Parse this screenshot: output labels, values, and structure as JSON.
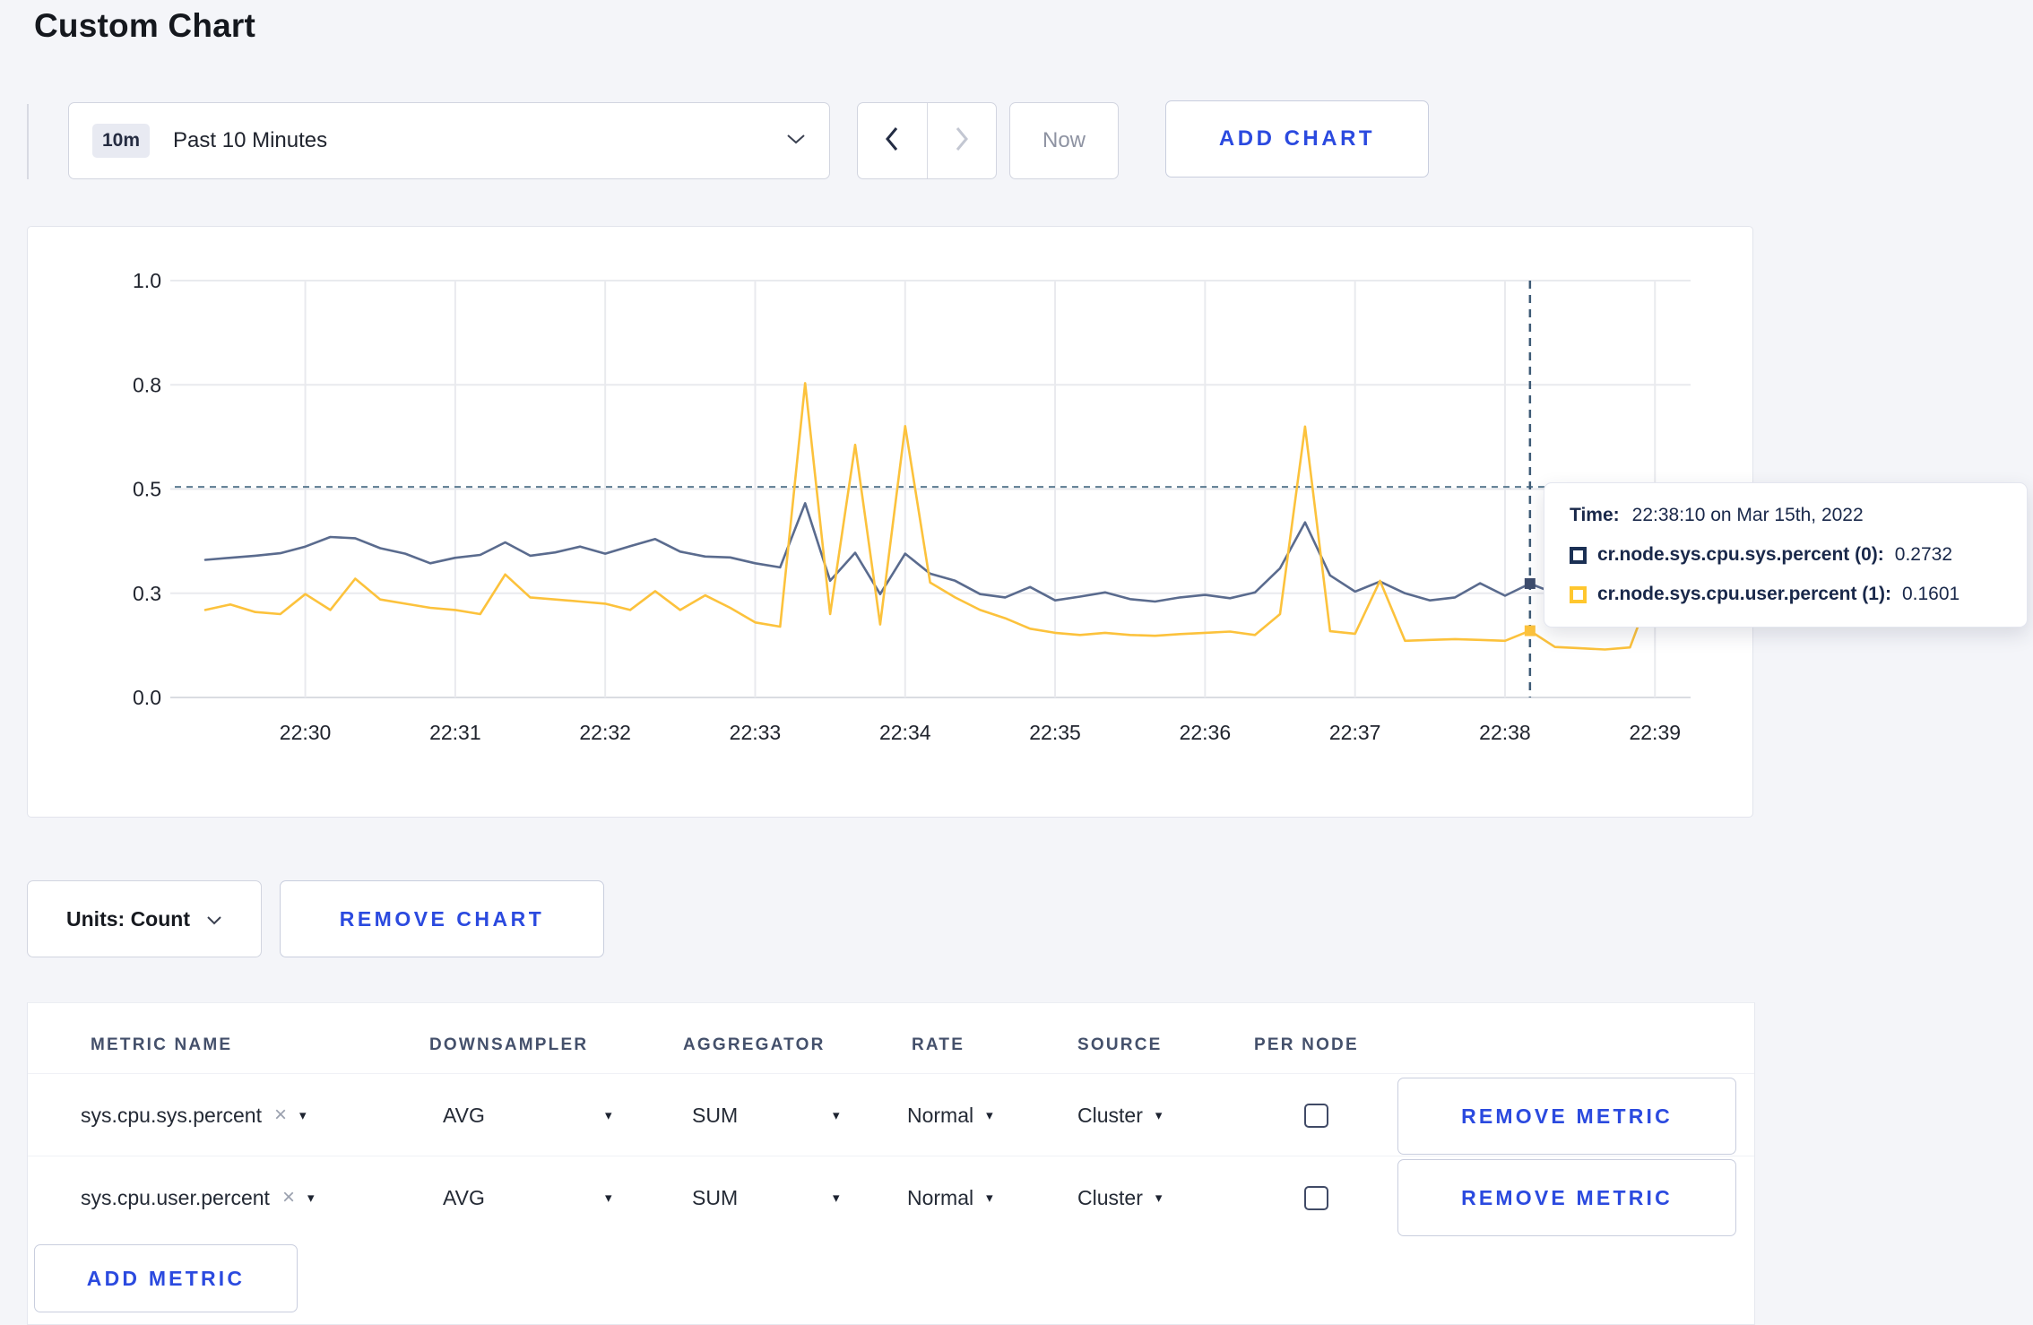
{
  "page": {
    "title": "Custom Chart"
  },
  "toolbar": {
    "time_badge": "10m",
    "time_label": "Past 10 Minutes",
    "now_label": "Now",
    "add_chart_label": "ADD CHART"
  },
  "controls": {
    "units_label": "Units: Count",
    "remove_chart_label": "REMOVE CHART"
  },
  "tooltip": {
    "time_label": "Time:",
    "time_value": "22:38:10 on Mar 15th, 2022",
    "series": [
      {
        "name": "cr.node.sys.cpu.sys.percent (0):",
        "value": "0.2732",
        "color": "#1b3054"
      },
      {
        "name": "cr.node.sys.cpu.user.percent (1):",
        "value": "0.1601",
        "color": "#ffc72e"
      }
    ]
  },
  "metrics_table": {
    "headers": [
      "METRIC NAME",
      "DOWNSAMPLER",
      "AGGREGATOR",
      "RATE",
      "SOURCE",
      "PER NODE"
    ],
    "clear_glyph": "×",
    "caret_glyph": "▾",
    "rows": [
      {
        "metric": "sys.cpu.sys.percent",
        "downsampler": "AVG",
        "aggregator": "SUM",
        "rate": "Normal",
        "source": "Cluster",
        "per_node_checked": false,
        "remove_label": "REMOVE METRIC"
      },
      {
        "metric": "sys.cpu.user.percent",
        "downsampler": "AVG",
        "aggregator": "SUM",
        "rate": "Normal",
        "source": "Cluster",
        "per_node_checked": false,
        "remove_label": "REMOVE METRIC"
      }
    ],
    "add_metric_label": "ADD METRIC"
  },
  "chart_data": {
    "type": "line",
    "title": "",
    "xlabel": "time",
    "ylabel": "",
    "ylim": [
      0,
      1
    ],
    "grid": true,
    "x_start": "22:29:20",
    "x_step_seconds": 10,
    "x_tick_labels": [
      "22:30",
      "22:31",
      "22:32",
      "22:33",
      "22:34",
      "22:35",
      "22:36",
      "22:37",
      "22:38",
      "22:39"
    ],
    "y_tick_labels": [
      "0.0",
      "0.3",
      "0.5",
      "0.8",
      "1.0"
    ],
    "y_tick_values": [
      0,
      0.25,
      0.5,
      0.75,
      1.0
    ],
    "hover_index": 53,
    "hover_time": "22:38:10",
    "hover_guide_value": 0.505,
    "series": [
      {
        "name": "cr.node.sys.cpu.sys.percent",
        "color": "#5a6b8e",
        "hover_value": 0.2732,
        "values": [
          0.33,
          0.335,
          0.34,
          0.346,
          0.362,
          0.385,
          0.382,
          0.358,
          0.345,
          0.322,
          0.335,
          0.342,
          0.372,
          0.34,
          0.348,
          0.362,
          0.345,
          0.363,
          0.38,
          0.35,
          0.338,
          0.336,
          0.322,
          0.312,
          0.466,
          0.28,
          0.347,
          0.248,
          0.345,
          0.297,
          0.28,
          0.248,
          0.24,
          0.265,
          0.233,
          0.242,
          0.252,
          0.236,
          0.23,
          0.24,
          0.246,
          0.238,
          0.252,
          0.31,
          0.42,
          0.293,
          0.254,
          0.278,
          0.25,
          0.233,
          0.24,
          0.274,
          0.244,
          0.2732,
          0.25,
          0.258,
          0.27,
          0.31,
          0.292,
          0.3
        ]
      },
      {
        "name": "cr.node.sys.cpu.user.percent",
        "color": "#fcc23c",
        "hover_value": 0.1601,
        "values": [
          0.21,
          0.223,
          0.205,
          0.2,
          0.248,
          0.21,
          0.285,
          0.235,
          0.225,
          0.215,
          0.21,
          0.2,
          0.295,
          0.24,
          0.235,
          0.23,
          0.225,
          0.21,
          0.255,
          0.21,
          0.245,
          0.215,
          0.18,
          0.17,
          0.754,
          0.2,
          0.606,
          0.175,
          0.651,
          0.276,
          0.24,
          0.21,
          0.19,
          0.165,
          0.155,
          0.15,
          0.155,
          0.15,
          0.148,
          0.152,
          0.155,
          0.158,
          0.15,
          0.2,
          0.65,
          0.159,
          0.153,
          0.28,
          0.136,
          0.138,
          0.14,
          0.138,
          0.136,
          0.1601,
          0.121,
          0.118,
          0.115,
          0.12,
          0.28,
          0.235
        ]
      }
    ],
    "legend": "none"
  }
}
